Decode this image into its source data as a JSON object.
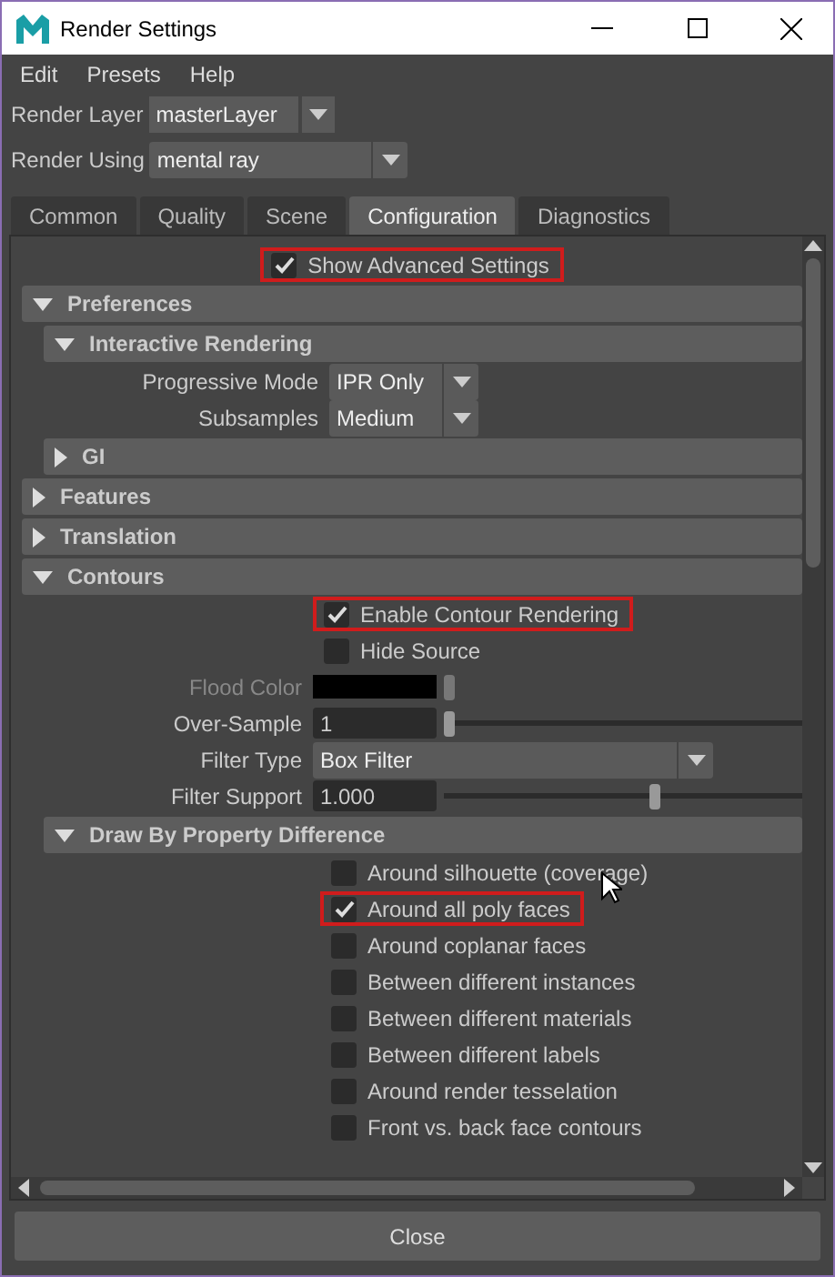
{
  "window": {
    "title": "Render Settings"
  },
  "menu": [
    "Edit",
    "Presets",
    "Help"
  ],
  "render_layer": {
    "label": "Render Layer",
    "value": "masterLayer"
  },
  "render_using": {
    "label": "Render Using",
    "value": "mental ray"
  },
  "tabs": [
    {
      "label": "Common",
      "selected": false
    },
    {
      "label": "Quality",
      "selected": false
    },
    {
      "label": "Scene",
      "selected": false
    },
    {
      "label": "Configuration",
      "selected": true
    },
    {
      "label": "Diagnostics",
      "selected": false
    }
  ],
  "show_advanced": {
    "label": "Show Advanced Settings",
    "checked": true,
    "highlighted": true
  },
  "sections": [
    {
      "title": "Preferences",
      "expanded": true,
      "children": [
        {
          "title": "Interactive Rendering",
          "expanded": true,
          "rows": [
            {
              "kind": "dropdown",
              "label": "Progressive Mode",
              "value": "IPR Only"
            },
            {
              "kind": "dropdown",
              "label": "Subsamples",
              "value": "Medium"
            }
          ]
        },
        {
          "title": "GI",
          "expanded": false
        }
      ]
    },
    {
      "title": "Features",
      "expanded": false
    },
    {
      "title": "Translation",
      "expanded": false
    },
    {
      "title": "Contours",
      "expanded": true,
      "rows": [
        {
          "kind": "checkbox",
          "label": "Enable Contour Rendering",
          "checked": true,
          "highlighted": true
        },
        {
          "kind": "checkbox",
          "label": "Hide Source",
          "checked": false,
          "highlighted": false
        },
        {
          "kind": "color",
          "label": "Flood Color",
          "disabled": true
        },
        {
          "kind": "slider",
          "label": "Over-Sample",
          "value": "1",
          "level": 0
        },
        {
          "kind": "combobox",
          "label": "Filter Type",
          "value": "Box Filter"
        },
        {
          "kind": "slider",
          "label": "Filter Support",
          "value": "1.000",
          "level": 0.59
        }
      ],
      "children": [
        {
          "title": "Draw By Property Difference",
          "expanded": true,
          "rows": [
            {
              "kind": "checkbox",
              "label": "Around silhouette (coverage)",
              "checked": false,
              "highlighted": false
            },
            {
              "kind": "checkbox",
              "label": "Around all poly faces",
              "checked": true,
              "highlighted": true
            },
            {
              "kind": "checkbox",
              "label": "Around coplanar faces",
              "checked": false,
              "highlighted": false
            },
            {
              "kind": "checkbox",
              "label": "Between different instances",
              "checked": false,
              "highlighted": false
            },
            {
              "kind": "checkbox",
              "label": "Between different materials",
              "checked": false,
              "highlighted": false
            },
            {
              "kind": "checkbox",
              "label": "Between different labels",
              "checked": false,
              "highlighted": false
            },
            {
              "kind": "checkbox",
              "label": "Around render tesselation",
              "checked": false,
              "highlighted": false
            },
            {
              "kind": "checkbox",
              "label": "Front vs. back face contours",
              "checked": false,
              "highlighted": false
            }
          ]
        }
      ]
    }
  ],
  "close_button": "Close"
}
